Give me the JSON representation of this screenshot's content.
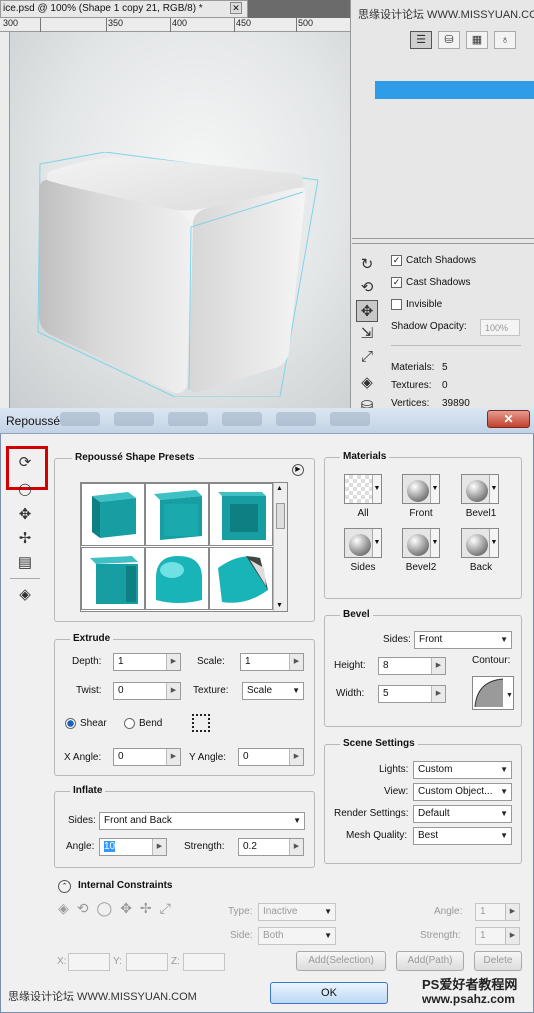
{
  "document": {
    "tab_title": "ice.psd @ 100% (Shape 1 copy 21, RGB/8) *",
    "close_glyph": "✕",
    "ruler_marks": [
      "300",
      "350",
      "400",
      "450",
      "500"
    ]
  },
  "top_panel": {
    "watermark": "思缘设计论坛 WWW.MISSYUAN.COM",
    "tabs": [
      "scene-icon",
      "mesh-icon",
      "materials-icon",
      "light-icon"
    ],
    "catch_shadows_label": "Catch Shadows",
    "catch_shadows_checked": true,
    "cast_shadows_label": "Cast Shadows",
    "cast_shadows_checked": true,
    "invisible_label": "Invisible",
    "invisible_checked": false,
    "shadow_opacity_label": "Shadow Opacity:",
    "shadow_opacity_value": "100%",
    "materials_label": "Materials:",
    "materials_value": "5",
    "textures_label": "Textures:",
    "textures_value": "0",
    "vertices_label": "Vertices:",
    "vertices_value": "39890"
  },
  "dialog": {
    "title": "Repoussé",
    "close_glyph": "✕",
    "presets_title": "Repoussé Shape Presets",
    "extrude": {
      "title": "Extrude",
      "depth_label": "Depth:",
      "depth_value": "1",
      "scale_label": "Scale:",
      "scale_value": "1",
      "twist_label": "Twist:",
      "twist_value": "0",
      "texture_label": "Texture:",
      "texture_value": "Scale",
      "shear_label": "Shear",
      "shear_selected": true,
      "bend_label": "Bend",
      "bend_selected": false,
      "xangle_label": "X Angle:",
      "xangle_value": "0",
      "yangle_label": "Y Angle:",
      "yangle_value": "0"
    },
    "inflate": {
      "title": "Inflate",
      "sides_label": "Sides:",
      "sides_value": "Front and Back",
      "angle_label": "Angle:",
      "angle_value": "10",
      "strength_label": "Strength:",
      "strength_value": "0.2"
    },
    "materials": {
      "title": "Materials",
      "items": [
        "All",
        "Front",
        "Bevel1",
        "Sides",
        "Bevel2",
        "Back"
      ]
    },
    "bevel": {
      "title": "Bevel",
      "sides_label": "Sides:",
      "sides_value": "Front",
      "height_label": "Height:",
      "height_value": "8",
      "width_label": "Width:",
      "width_value": "5",
      "contour_label": "Contour:"
    },
    "scene": {
      "title": "Scene Settings",
      "lights_label": "Lights:",
      "lights_value": "Custom",
      "view_label": "View:",
      "view_value": "Custom Object...",
      "render_label": "Render Settings:",
      "render_value": "Default",
      "mesh_label": "Mesh Quality:",
      "mesh_value": "Best"
    },
    "constraints": {
      "title": "Internal Constraints",
      "type_label": "Type:",
      "type_value": "Inactive",
      "side_label": "Side:",
      "side_value": "Both",
      "angle_label": "Angle:",
      "angle_value": "1",
      "strength_label": "Strength:",
      "strength_value": "1",
      "x_label": "X:",
      "y_label": "Y:",
      "z_label": "Z:",
      "add_selection_label": "Add(Selection)",
      "add_path_label": "Add(Path)",
      "delete_label": "Delete"
    },
    "ok_label": "OK"
  },
  "watermarks": {
    "bottom_left": "思缘设计论坛 WWW.MISSYUAN.COM",
    "bottom_right_line1": "PS爱好者教程网",
    "bottom_right_line2": "www.psahz.com"
  },
  "colors": {
    "accent_blue": "#2f9ce8",
    "highlight_red": "#d40000",
    "preset_teal": "#169ea2"
  }
}
